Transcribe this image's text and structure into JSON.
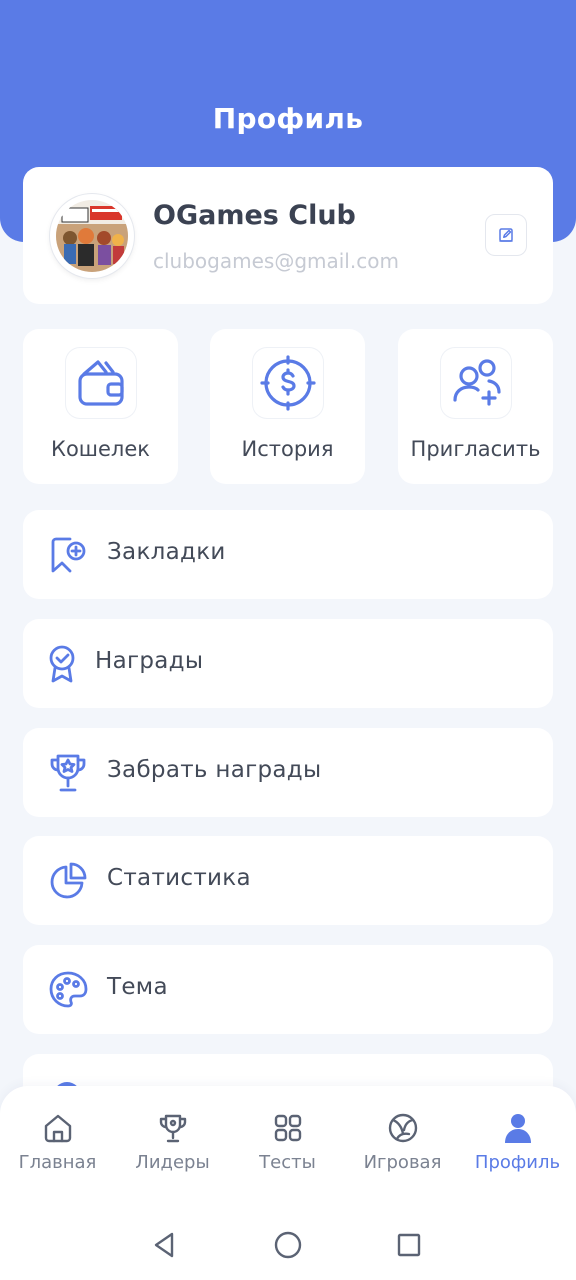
{
  "header": {
    "title": "Профиль"
  },
  "profile": {
    "name": "OGames Club",
    "email": "clubogames@gmail.com",
    "avatar_icon": "avatar-image",
    "edit_icon": "edit-icon"
  },
  "tiles": [
    {
      "label": "Кошелек",
      "icon": "wallet-icon"
    },
    {
      "label": "История",
      "icon": "dollar-circle-icon"
    },
    {
      "label": "Пригласить",
      "icon": "add-user-icon"
    }
  ],
  "menu": [
    {
      "label": "Закладки",
      "icon": "bookmark-add-icon"
    },
    {
      "label": "Награды",
      "icon": "award-badge-icon"
    },
    {
      "label": "Забрать награды",
      "icon": "trophy-star-icon"
    },
    {
      "label": "Статистика",
      "icon": "pie-chart-icon"
    },
    {
      "label": "Тема",
      "icon": "palette-icon"
    }
  ],
  "nav": [
    {
      "label": "Главная",
      "icon": "home-icon"
    },
    {
      "label": "Лидеры",
      "icon": "trophy-icon"
    },
    {
      "label": "Тесты",
      "icon": "grid-icon"
    },
    {
      "label": "Игровая",
      "icon": "ball-icon"
    },
    {
      "label": "Профиль",
      "icon": "user-icon",
      "active": true
    }
  ],
  "colors": {
    "accent": "#5a7be6",
    "background": "#f3f6fb",
    "card": "#ffffff",
    "text": "#434a58",
    "muted": "#c6cad3",
    "nav_inactive": "#7b8291"
  }
}
